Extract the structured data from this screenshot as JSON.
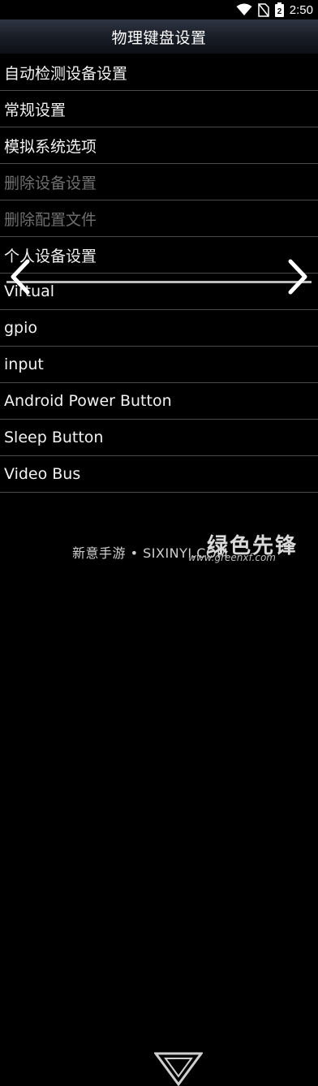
{
  "status_bar": {
    "time": "2:50",
    "battery_digit": "2"
  },
  "title_bar": {
    "title": "物理键盘设置"
  },
  "list": {
    "items": [
      {
        "label": "自动检测设备设置",
        "enabled": true
      },
      {
        "label": "常规设置",
        "enabled": true
      },
      {
        "label": "模拟系统选项",
        "enabled": true
      },
      {
        "label": "删除设备设置",
        "enabled": false
      },
      {
        "label": "删除配置文件",
        "enabled": false
      },
      {
        "label": "个人设备设置",
        "enabled": true
      },
      {
        "label": "Virtual",
        "enabled": true
      },
      {
        "label": "gpio",
        "enabled": true
      },
      {
        "label": "input",
        "enabled": true
      },
      {
        "label": "Android Power Button",
        "enabled": true
      },
      {
        "label": "Sleep Button",
        "enabled": true
      },
      {
        "label": "Video Bus",
        "enabled": true
      }
    ]
  },
  "watermark": {
    "text": "新意手游 • SIXINYI.COM",
    "logo_text": "绿色先锋",
    "url": "www.greenxf.com"
  },
  "colors": {
    "background": "#000000",
    "divider": "#4a4a4a",
    "disabled_text": "#6f6f6f",
    "title_gradient_top": "#2f3644"
  }
}
